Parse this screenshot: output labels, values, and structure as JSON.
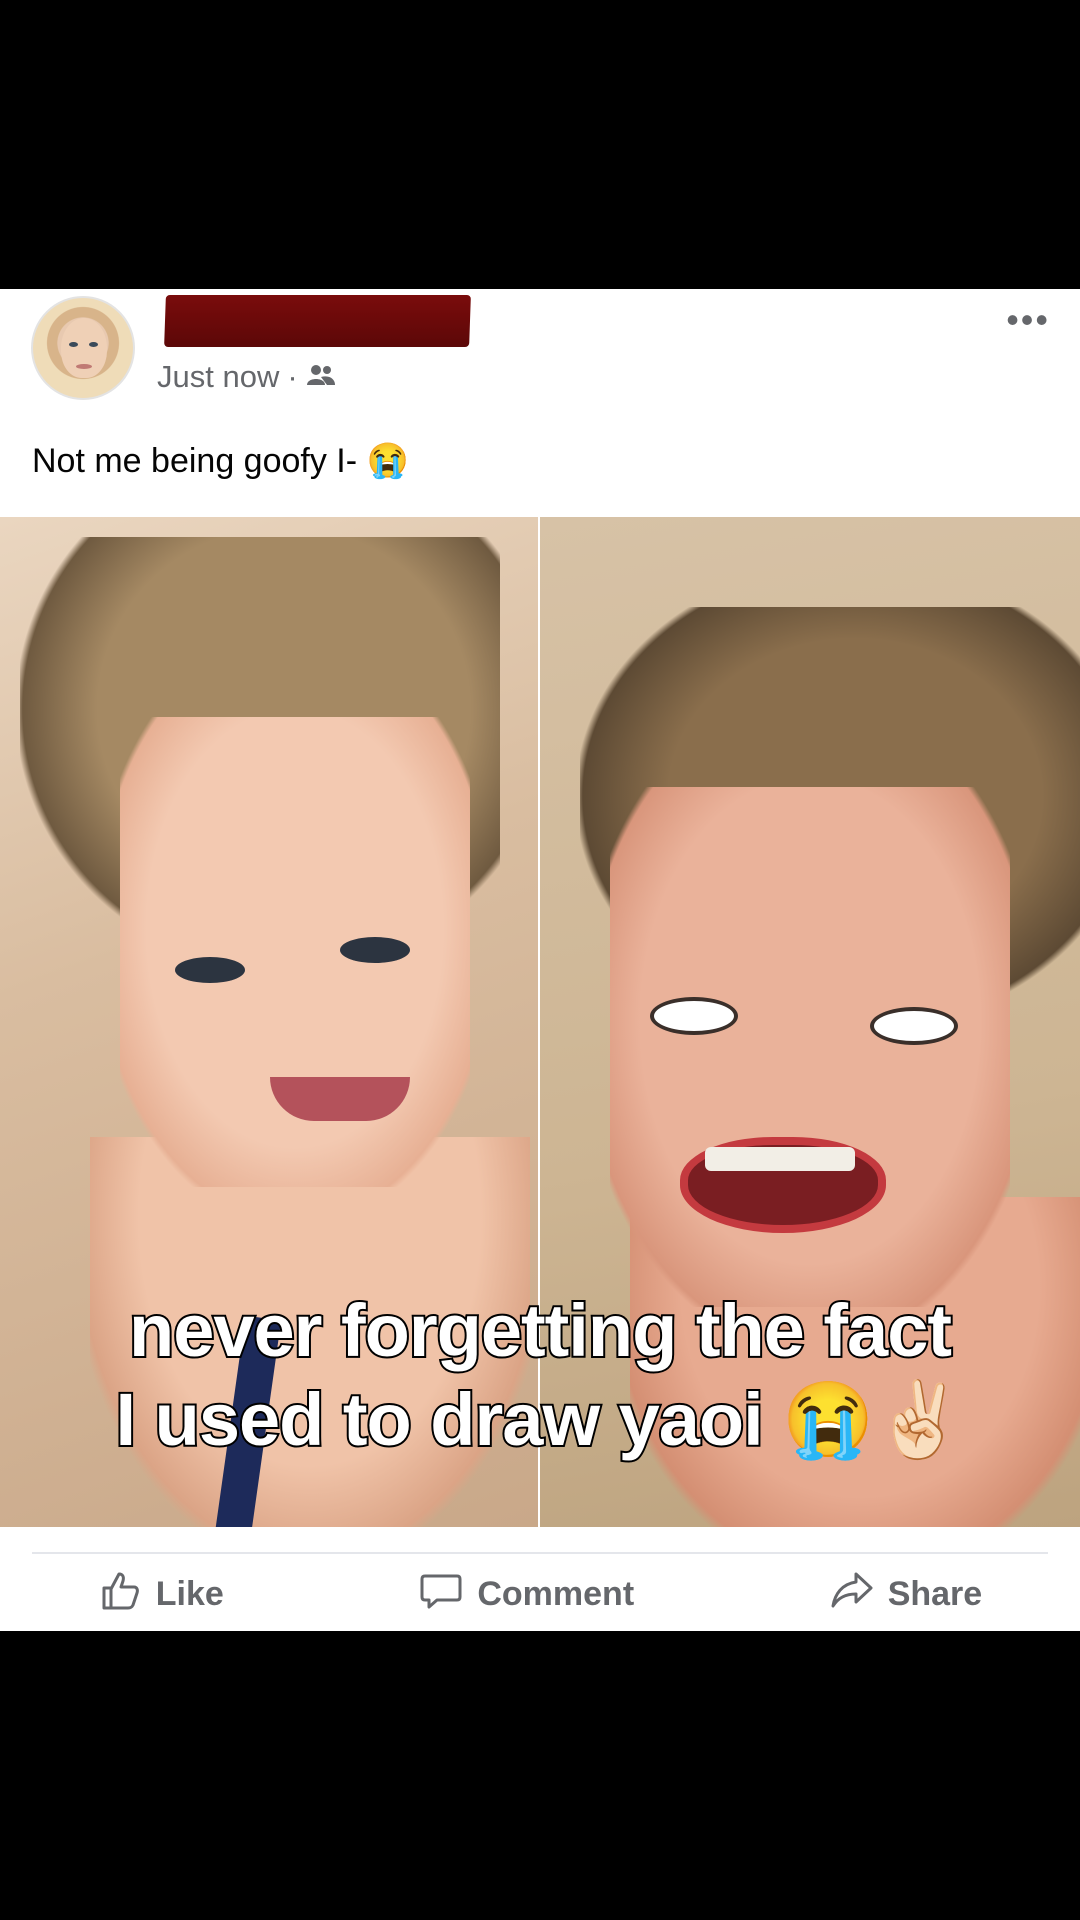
{
  "post": {
    "author_name": "",
    "timestamp": "Just now",
    "separator": "·",
    "audience_icon": "friends-icon",
    "more_label": "•••",
    "caption": "Not me being goofy I-",
    "caption_emoji": "😭"
  },
  "media": {
    "overlay_line1": "never forgetting the fact",
    "overlay_line2": "I used to draw yaoi 😭✌🏻"
  },
  "actions": {
    "like_label": "Like",
    "comment_label": "Comment",
    "share_label": "Share"
  },
  "colors": {
    "redaction": "#6b0a0a",
    "meta_text": "#65676b",
    "background": "#000000"
  }
}
